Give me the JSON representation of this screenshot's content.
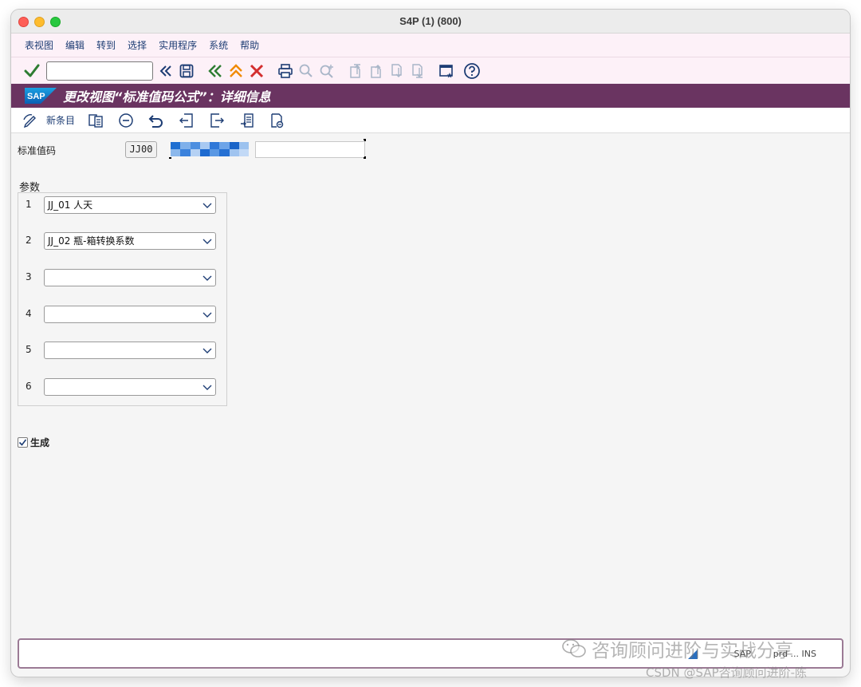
{
  "window": {
    "title": "S4P (1) (800)"
  },
  "menu": {
    "items": [
      "表视图",
      "编辑",
      "转到",
      "选择",
      "实用程序",
      "系统",
      "帮助"
    ]
  },
  "toolbar": {
    "command_field_value": "",
    "icons": [
      "confirm-check-icon",
      "collapse-double-left-icon",
      "save-icon",
      "back-icon",
      "exit-icon",
      "cancel-icon",
      "print-icon",
      "find-icon",
      "find-next-icon",
      "first-page-icon",
      "previous-page-icon",
      "next-page-icon",
      "last-page-icon",
      "create-session-icon",
      "help-icon"
    ]
  },
  "app": {
    "logo_text": "SAP",
    "title": "更改视图“标准值码公式”：详细信息"
  },
  "app_toolbar": {
    "new_entries_label": "新条目",
    "icons": [
      "display-change-icon",
      "copy-as-icon",
      "delete-icon",
      "undo-change-icon",
      "previous-entry-icon",
      "next-entry-icon",
      "select-all-icon",
      "other-entry-icon"
    ]
  },
  "form": {
    "std_value_key_label": "标准值码",
    "std_value_key": "JJ00",
    "description_value": "",
    "params_group_title": "参数",
    "params": [
      {
        "num": "1",
        "value": "JJ_01  人天"
      },
      {
        "num": "2",
        "value": "JJ_02  瓶-箱转换系数"
      },
      {
        "num": "3",
        "value": ""
      },
      {
        "num": "4",
        "value": ""
      },
      {
        "num": "5",
        "value": ""
      },
      {
        "num": "6",
        "value": ""
      }
    ],
    "generate_label": "生成",
    "generate_checked": true
  },
  "status": {
    "system": "SAP",
    "client_info": "prd ... INS"
  },
  "watermark": {
    "main": "咨询顾问进阶与实战分享",
    "sub": "CSDN @SAP咨询顾问进阶-陈"
  },
  "colors": {
    "title_band": "#6a3461",
    "menu_bg": "#fdf1f8",
    "link_blue": "#1d3d74",
    "confirm_green": "#2e7d32",
    "cancel_red": "#d32f2f",
    "back_orange": "#f08a00"
  }
}
